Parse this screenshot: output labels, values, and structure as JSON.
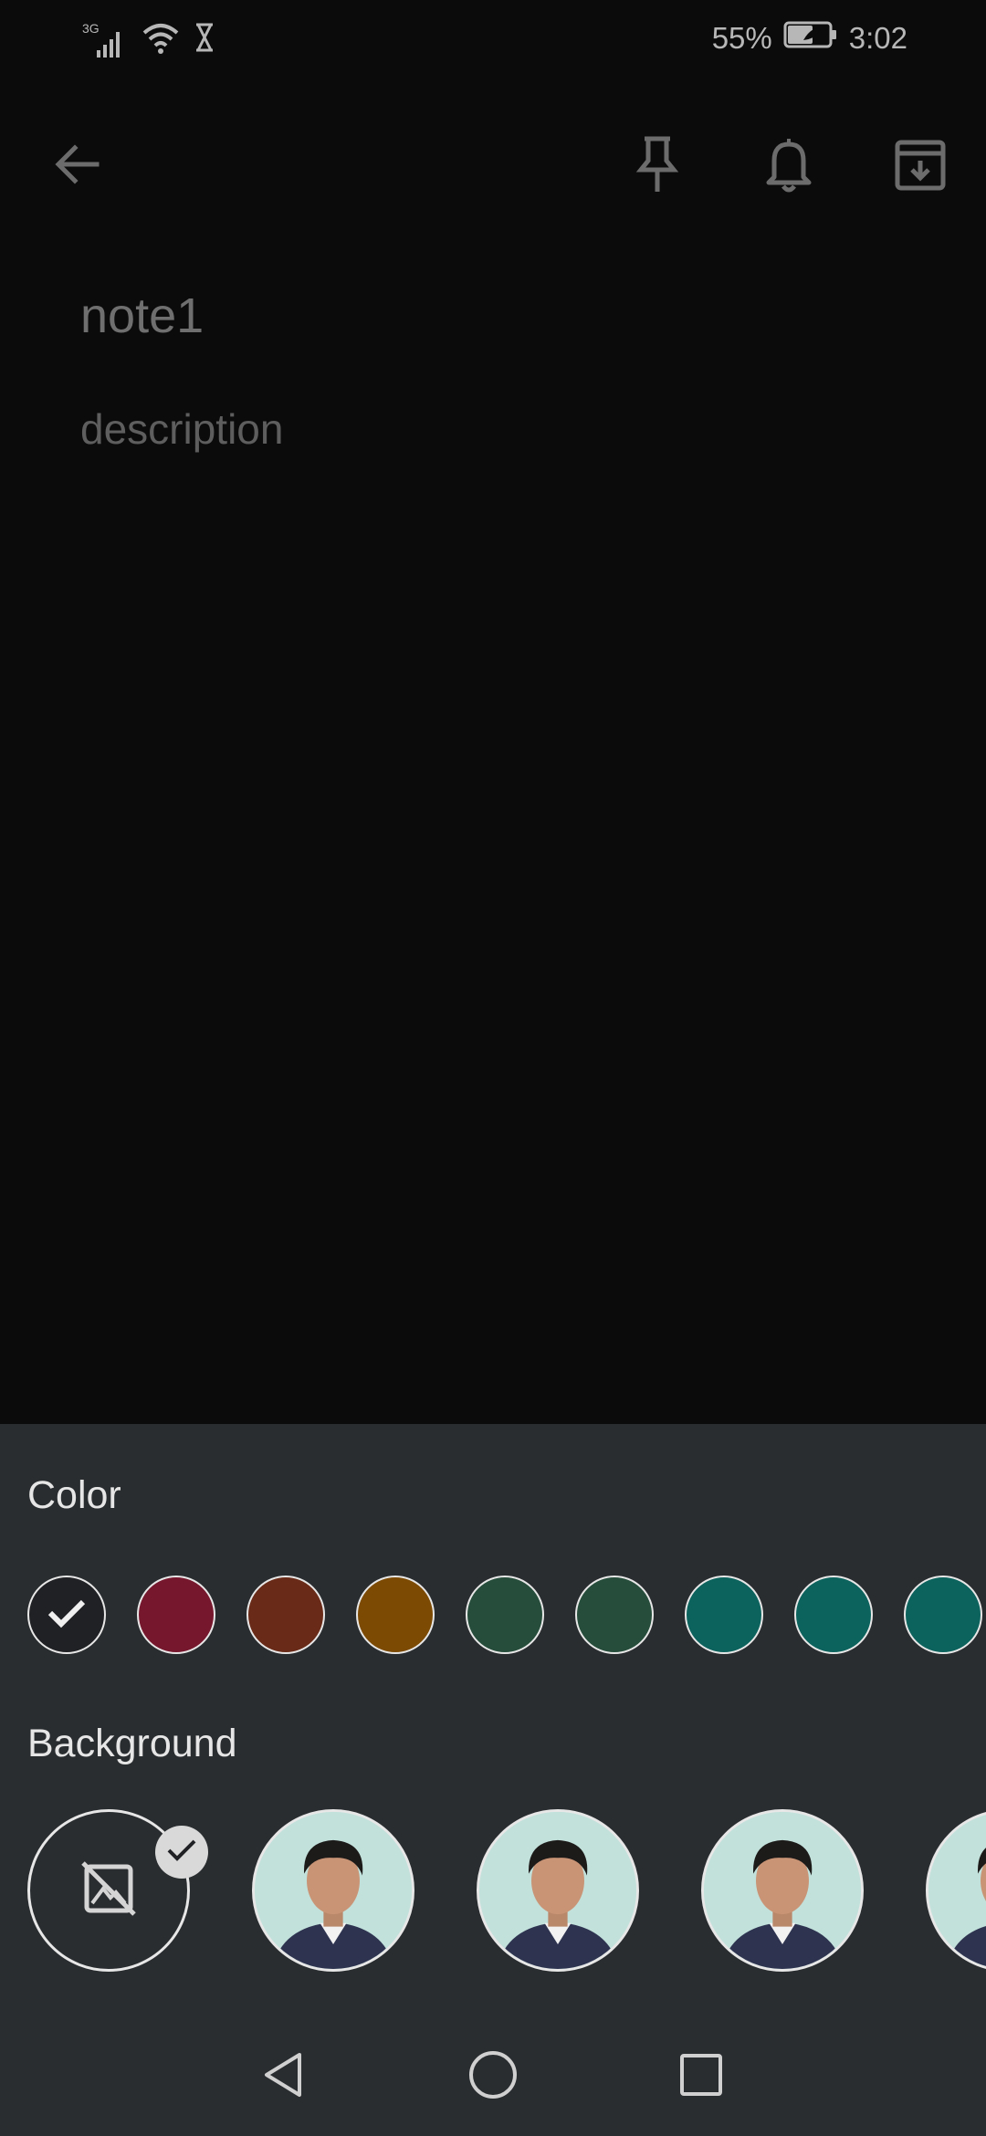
{
  "status_bar": {
    "network_type": "3G",
    "battery_percent": "55%",
    "time": "3:02",
    "icons": [
      "signal-icon",
      "wifi-icon",
      "hourglass-icon",
      "battery-saver-icon"
    ]
  },
  "app_bar": {
    "icons": [
      "back-arrow-icon",
      "pin-icon",
      "bell-icon",
      "archive-icon"
    ]
  },
  "note": {
    "title": "note1",
    "description": "description"
  },
  "sheet": {
    "color_label": "Color",
    "background_label": "Background",
    "colors": [
      {
        "name": "default",
        "hex": "#202124",
        "selected": true
      },
      {
        "name": "red",
        "hex": "#77172e",
        "selected": false
      },
      {
        "name": "orange",
        "hex": "#692b17",
        "selected": false
      },
      {
        "name": "yellow",
        "hex": "#7c4a03",
        "selected": false
      },
      {
        "name": "green",
        "hex": "#264d3b",
        "selected": false
      },
      {
        "name": "teal",
        "hex": "#264d3b",
        "selected": false
      },
      {
        "name": "blue",
        "hex": "#0c625d",
        "selected": false
      },
      {
        "name": "dark-blue",
        "hex": "#0c625d",
        "selected": false
      },
      {
        "name": "purple",
        "hex": "#0c625d",
        "selected": false
      }
    ],
    "backgrounds": [
      {
        "name": "no-background",
        "selected": true
      },
      {
        "name": "portrait-1",
        "selected": false
      },
      {
        "name": "portrait-2",
        "selected": false
      },
      {
        "name": "portrait-3",
        "selected": false
      },
      {
        "name": "portrait-4",
        "selected": false
      }
    ]
  },
  "nav_bar": {
    "icons": [
      "nav-back-icon",
      "nav-home-icon",
      "nav-recents-icon"
    ]
  },
  "colors": {
    "background": "#0b0b0c",
    "sheet": "#2a2d30",
    "text_primary": "#e6e6e6",
    "text_muted": "#6f6f6f"
  }
}
